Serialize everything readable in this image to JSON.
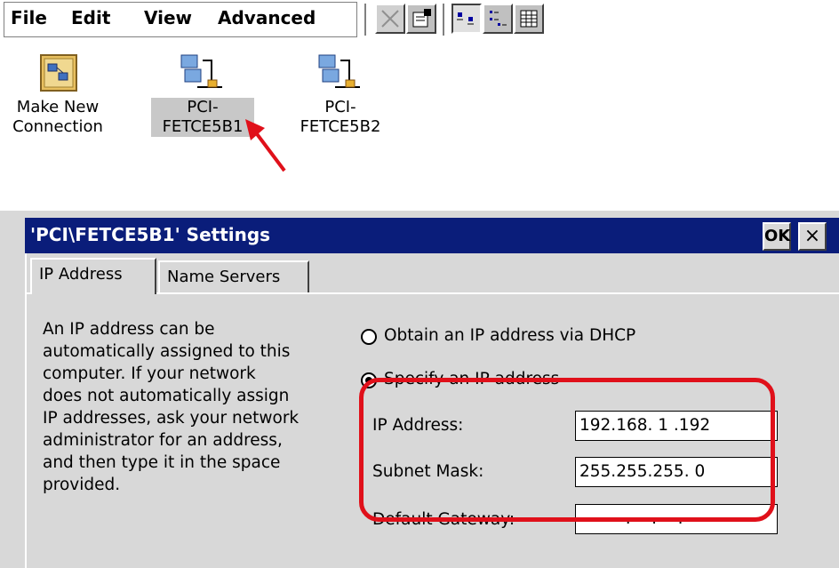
{
  "menu": {
    "file": "File",
    "edit": "Edit",
    "view": "View",
    "advanced": "Advanced"
  },
  "toolbar": {
    "buttons": [
      "delete-icon",
      "properties-icon",
      "large-icons-icon",
      "small-icons-icon",
      "details-icon"
    ]
  },
  "desktop": {
    "items": [
      {
        "label_line1": "Make New",
        "label_line2": "Connection",
        "icon": "make-connection-icon"
      },
      {
        "label_line1": "PCI-",
        "label_line2": "FETCE5B1",
        "icon": "network-adapter-icon",
        "selected": true
      },
      {
        "label_line1": "PCI-",
        "label_line2": "FETCE5B2",
        "icon": "network-adapter-icon"
      }
    ]
  },
  "dialog": {
    "title": "'PCI\\FETCE5B1' Settings",
    "ok_label": "OK",
    "close_label": "×",
    "tabs": [
      "IP Address",
      "Name Servers"
    ],
    "description": "An IP address can be\nautomatically assigned to this\ncomputer.  If your network\ndoes not automatically assign\nIP addresses, ask your network\nadministrator for an address,\nand then type it in the space\nprovided.",
    "options": {
      "dhcp": "Obtain an IP address via DHCP",
      "specify": "Specify an IP address",
      "selected": "specify"
    },
    "fields": {
      "ip_label": "IP Address:",
      "ip_value": "192.168. 1 .192",
      "mask_label": "Subnet Mask:",
      "mask_value": "255.255.255. 0",
      "gateway_label": "Default Gateway:",
      "gateway_value": "  .    .    ."
    }
  },
  "colors": {
    "titlebar": "#0a1d7a",
    "highlight": "#e0101a",
    "arrow": "#e0101a",
    "dialog_bg": "#d8d8d8"
  }
}
